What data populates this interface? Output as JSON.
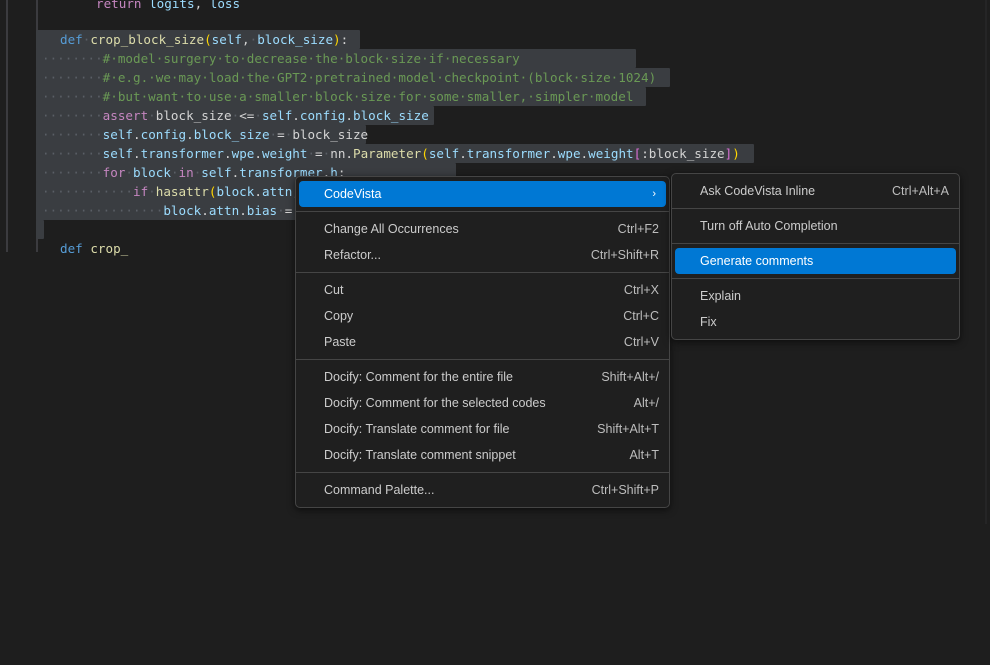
{
  "editor": {
    "theme_bg": "#1e1e1e",
    "selection_color": "#3a3d41",
    "lines": [
      {
        "indent": 0,
        "text": "        return logits, loss"
      },
      {
        "indent": 0,
        "text": ""
      },
      {
        "indent": 0,
        "text": "    def crop_block_size(self, block_size):"
      },
      {
        "indent": 0,
        "text": "        # model surgery to decrease the block size if necessary"
      },
      {
        "indent": 0,
        "text": "        # e.g. we may load the GPT2 pretrained model checkpoint (block size 1024)"
      },
      {
        "indent": 0,
        "text": "        # but want to use a smaller block size for some smaller, simpler model"
      },
      {
        "indent": 0,
        "text": "        assert block_size <= self.config.block_size"
      },
      {
        "indent": 0,
        "text": "        self.config.block_size = block_size"
      },
      {
        "indent": 0,
        "text": "        self.transformer.wpe.weight = nn.Parameter(self.transformer.wpe.weight[:block_size])"
      },
      {
        "indent": 0,
        "text": "        for block in self.transformer.h:"
      },
      {
        "indent": 0,
        "text": "            if hasattr(block.attn, 'bias'):"
      },
      {
        "indent": 0,
        "text": "                block.attn.bias = block.attn.bias[:,:,:block_size,:block_size]"
      },
      {
        "indent": 0,
        "text": ""
      },
      {
        "indent": 0,
        "text": "    def crop_"
      }
    ]
  },
  "context_menu": {
    "name": "editor-context-menu",
    "groups": [
      {
        "items": [
          {
            "label": "CodeVista",
            "keybind": "",
            "submenu": true,
            "highlighted": true
          }
        ]
      },
      {
        "items": [
          {
            "label": "Change All Occurrences",
            "keybind": "Ctrl+F2",
            "submenu": false,
            "highlighted": false
          },
          {
            "label": "Refactor...",
            "keybind": "Ctrl+Shift+R",
            "submenu": false,
            "highlighted": false
          }
        ]
      },
      {
        "items": [
          {
            "label": "Cut",
            "keybind": "Ctrl+X",
            "submenu": false,
            "highlighted": false
          },
          {
            "label": "Copy",
            "keybind": "Ctrl+C",
            "submenu": false,
            "highlighted": false
          },
          {
            "label": "Paste",
            "keybind": "Ctrl+V",
            "submenu": false,
            "highlighted": false
          }
        ]
      },
      {
        "items": [
          {
            "label": "Docify: Comment for the entire file",
            "keybind": "Shift+Alt+/",
            "submenu": false,
            "highlighted": false
          },
          {
            "label": "Docify: Comment for the selected codes",
            "keybind": "Alt+/",
            "submenu": false,
            "highlighted": false
          },
          {
            "label": "Docify: Translate comment for file",
            "keybind": "Shift+Alt+T",
            "submenu": false,
            "highlighted": false
          },
          {
            "label": "Docify: Translate comment snippet",
            "keybind": "Alt+T",
            "submenu": false,
            "highlighted": false
          }
        ]
      },
      {
        "items": [
          {
            "label": "Command Palette...",
            "keybind": "Ctrl+Shift+P",
            "submenu": false,
            "highlighted": false
          }
        ]
      }
    ]
  },
  "submenu": {
    "name": "codevista-submenu",
    "groups": [
      {
        "items": [
          {
            "label": "Ask CodeVista Inline",
            "keybind": "Ctrl+Alt+A",
            "highlighted": false
          }
        ]
      },
      {
        "items": [
          {
            "label": "Turn off Auto Completion",
            "keybind": "",
            "highlighted": false
          }
        ]
      },
      {
        "items": [
          {
            "label": "Generate comments",
            "keybind": "",
            "highlighted": true
          }
        ]
      },
      {
        "items": [
          {
            "label": "Explain",
            "keybind": "",
            "highlighted": false
          },
          {
            "label": "Fix",
            "keybind": "",
            "highlighted": false
          }
        ]
      }
    ]
  },
  "colors": {
    "accent": "#0078d4",
    "menu_bg": "#1f1f1f",
    "menu_border": "#454545",
    "editor_bg": "#1e1e1e"
  },
  "icons": {
    "submenu_chevron": "›"
  }
}
